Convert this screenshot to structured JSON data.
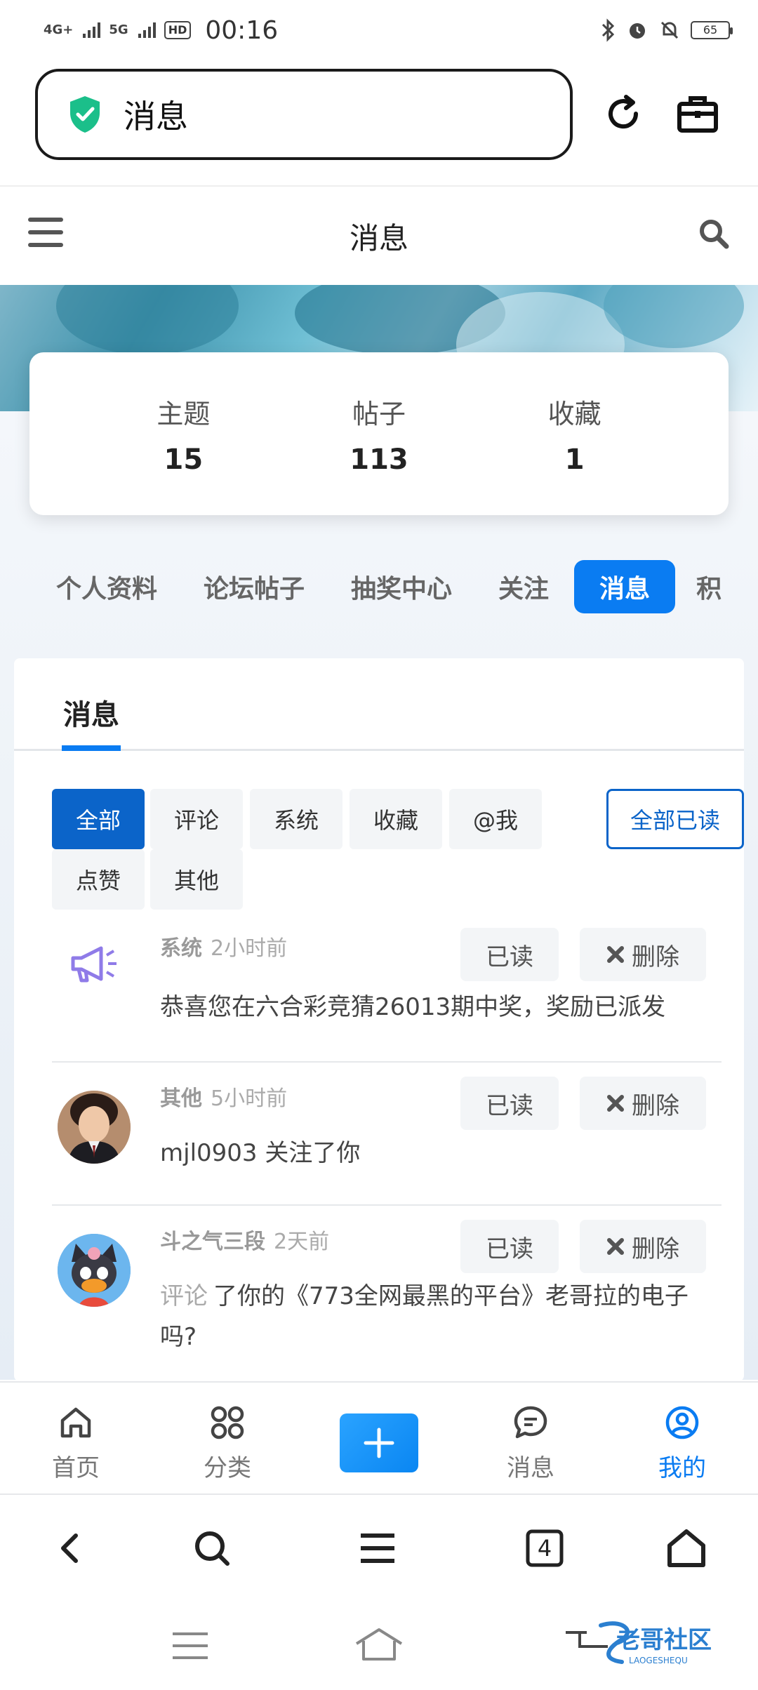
{
  "status_bar": {
    "network_1": "4G+",
    "network_2": "5G",
    "hd_badge": "HD",
    "time": "00:16",
    "battery": "65"
  },
  "browser": {
    "url_title": "消息",
    "tabs_count": "4"
  },
  "site_header": {
    "title": "消息"
  },
  "stats": [
    {
      "label": "主题",
      "value": "15"
    },
    {
      "label": "帖子",
      "value": "113"
    },
    {
      "label": "收藏",
      "value": "1"
    }
  ],
  "profile_nav": [
    "个人资料",
    "论坛帖子",
    "抽奖中心",
    "关注",
    "消息",
    "积"
  ],
  "panel": {
    "tab": "消息",
    "filters": [
      "全部",
      "评论",
      "系统",
      "收藏",
      "@我",
      "点赞",
      "其他"
    ],
    "read_all": "全部已读"
  },
  "messages": [
    {
      "category": "系统",
      "time": "2小时前",
      "text": "恭喜您在六合彩竞猜26013期中奖，奖励已派发",
      "read_label": "已读",
      "delete_label": "删除"
    },
    {
      "category": "其他",
      "time": "5小时前",
      "text": "mjl0903 关注了你",
      "read_label": "已读",
      "delete_label": "删除"
    },
    {
      "category": "斗之气三段",
      "time": "2天前",
      "prefix": "评论",
      "text": "了你的《773全网最黑的平台》老哥拉的电子吗?",
      "read_label": "已读",
      "delete_label": "删除"
    }
  ],
  "app_tabs": [
    {
      "label": "首页",
      "icon": "home-icon"
    },
    {
      "label": "分类",
      "icon": "grid-icon"
    },
    {
      "label": "消息",
      "icon": "chat-icon"
    },
    {
      "label": "我的",
      "icon": "user-circle-icon"
    }
  ],
  "watermark": {
    "text": "老哥社区",
    "sub": "LAOGESHEQU"
  },
  "colors": {
    "accent": "#0a7cf2",
    "filter_active": "#0b64c9",
    "shield": "#1bbf8a"
  }
}
